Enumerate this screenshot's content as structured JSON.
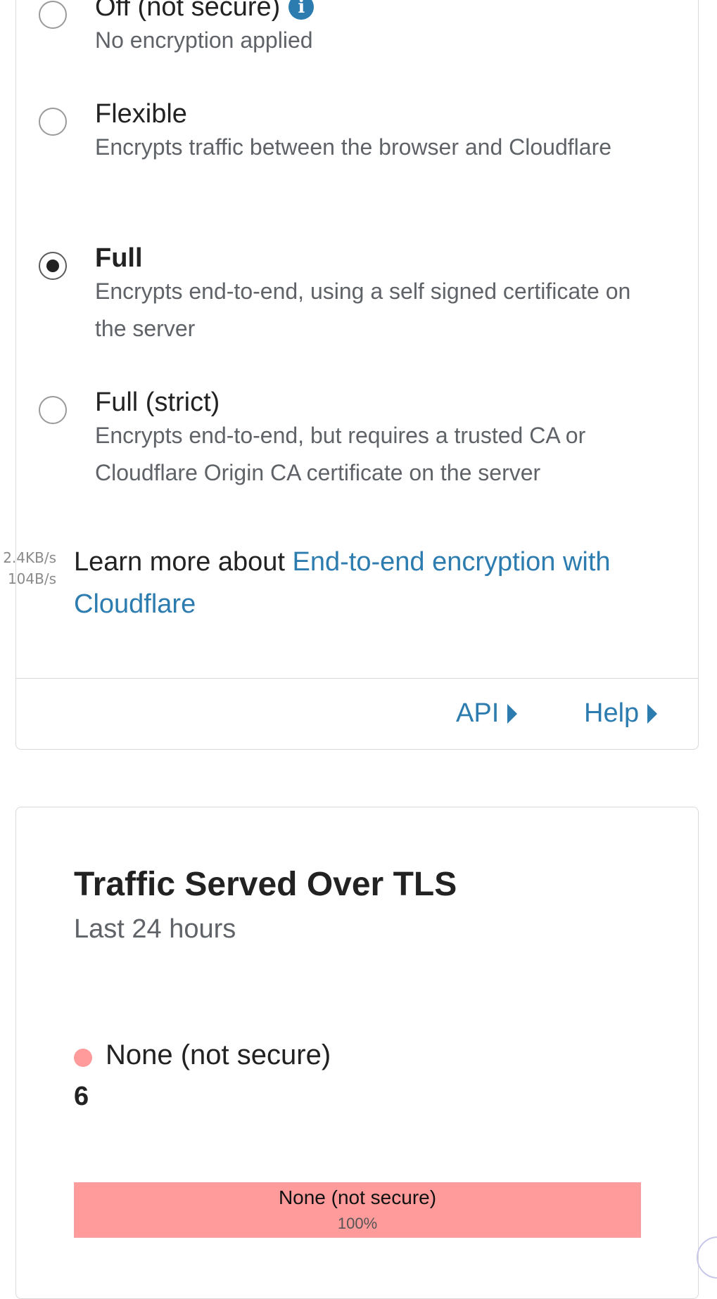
{
  "ssl_options": [
    {
      "title": "Off (not secure)",
      "description": "No encryption applied",
      "selected": false,
      "has_info_icon": true
    },
    {
      "title": "Flexible",
      "description": "Encrypts traffic between the browser and Cloudflare",
      "selected": false
    },
    {
      "title": "Full",
      "description": "Encrypts end-to-end, using a self signed certificate on the server",
      "selected": true
    },
    {
      "title": "Full (strict)",
      "description": "Encrypts end-to-end, but requires a trusted CA or Cloudflare Origin CA certificate on the server",
      "selected": false
    }
  ],
  "info_icon_glyph": "i",
  "learn_more": {
    "prefix": "Learn more about ",
    "link_text": "End-to-end encryption with Cloudflare"
  },
  "network_speed": {
    "down": "2.4KB/s",
    "up": "104B/s"
  },
  "footer": {
    "api_label": "API",
    "help_label": "Help"
  },
  "tls_card": {
    "title": "Traffic Served Over TLS",
    "subtitle": "Last 24 hours",
    "legend_label": "None (not secure)",
    "legend_count": "6",
    "bar_label": "None (not secure)",
    "bar_percent_label": "100%",
    "bar_fraction": 1.0,
    "bar_color": "#ff9b9b"
  },
  "colors": {
    "link": "#2c7cb0",
    "text": "#222222",
    "muted": "#5f6368"
  }
}
